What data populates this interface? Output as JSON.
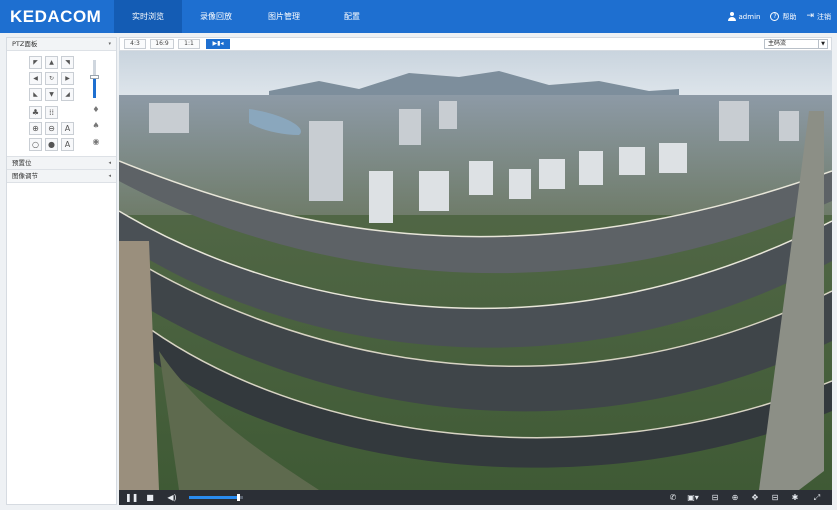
{
  "header": {
    "logo": "KEDACOM",
    "tabs": [
      {
        "label": "实时浏览",
        "active": true
      },
      {
        "label": "录像回放",
        "active": false
      },
      {
        "label": "图片管理",
        "active": false
      },
      {
        "label": "配置",
        "active": false
      }
    ],
    "user": "admin",
    "help": "帮助",
    "logout": "注销"
  },
  "sidebar": {
    "ptz_title": "PTZ面板",
    "preset_title": "预置位",
    "image_title": "图像调节",
    "speed_level": 0.55
  },
  "toolbar": {
    "ratios": [
      "4:3",
      "16:9",
      "1:1"
    ],
    "stream": "主码流"
  },
  "player": {
    "volume_level": 0.9
  },
  "colors": {
    "brand_blue": "#1e6fd0",
    "nav_active": "#145cb4",
    "control_bar": "#2b2f36"
  }
}
